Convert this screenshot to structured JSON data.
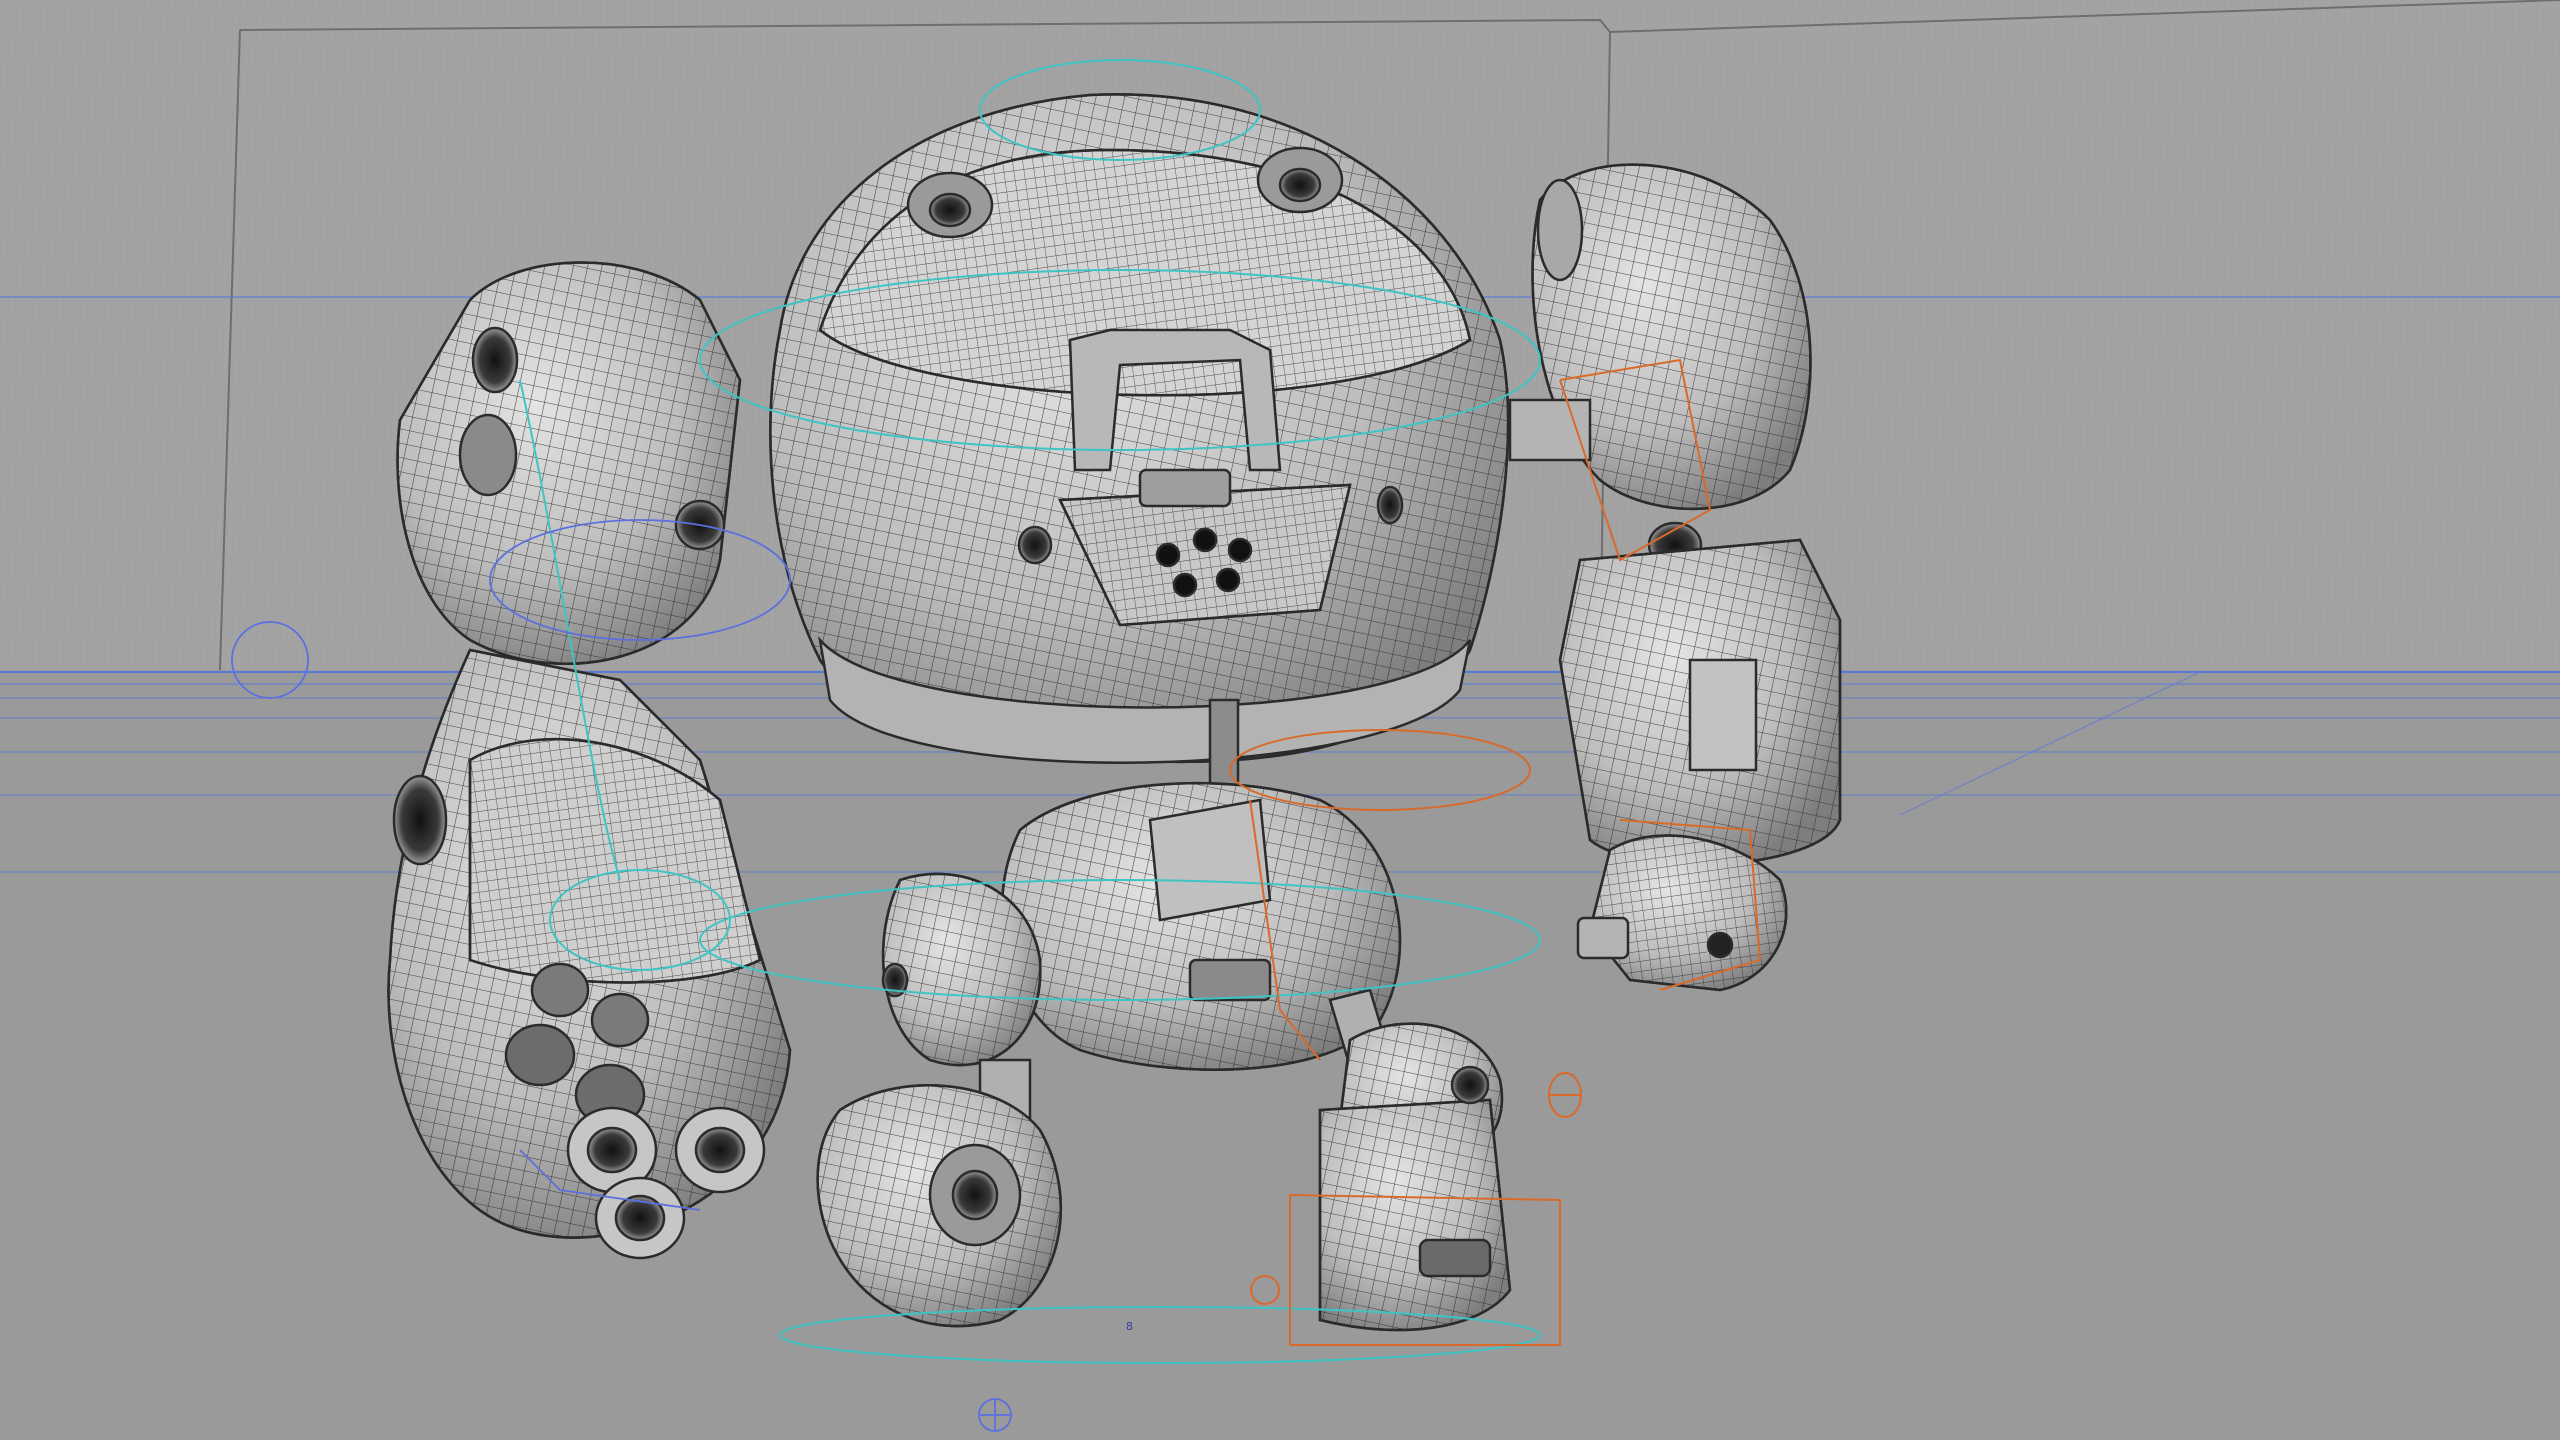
{
  "viewport": {
    "frame_marker": "8",
    "colors": {
      "background": "#9c9c9c",
      "wall": "#a2a2a2",
      "floor": "#9a9a9a",
      "mesh_fill": "#c6c6c6",
      "mesh_shade": "#8e8e8e",
      "wire": "#2b2b2b",
      "rig_cyan": "#3fc4c4",
      "rig_orange": "#d96a2a",
      "rig_blue": "#5b6fe0",
      "grid_blue": "#5a7ad8"
    },
    "objects": [
      {
        "name": "robot-mesh",
        "kind": "polygon-mesh"
      },
      {
        "name": "rig-controls-cyan",
        "kind": "curve-controls"
      },
      {
        "name": "rig-controls-orange",
        "kind": "curve-controls"
      },
      {
        "name": "rig-controls-blue",
        "kind": "curve-controls"
      },
      {
        "name": "backdrop-wall",
        "kind": "environment"
      },
      {
        "name": "floor-grid",
        "kind": "environment"
      }
    ]
  }
}
